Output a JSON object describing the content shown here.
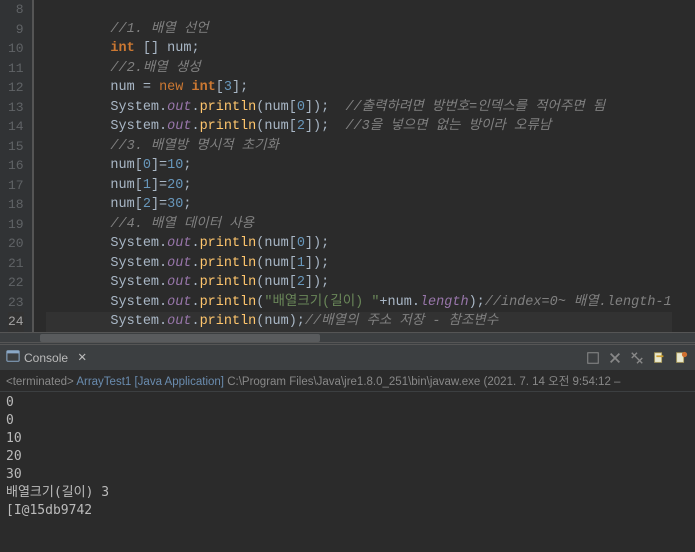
{
  "editor": {
    "lines": [
      {
        "n": 8,
        "html": ""
      },
      {
        "n": 9,
        "html": "        <span class='cm'>//1. 배열 선언</span>"
      },
      {
        "n": 10,
        "html": "        <span class='type'>int</span> <span class='pn'>[]</span> <span class='var'>num</span><span class='pn'>;</span>"
      },
      {
        "n": 11,
        "html": "        <span class='cm'>//2.배열 생성</span>"
      },
      {
        "n": 12,
        "html": "        <span class='var'>num</span> <span class='op'>=</span> <span class='kw'>new</span> <span class='type'>int</span><span class='pn'>[</span><span class='num'>3</span><span class='pn'>];</span>"
      },
      {
        "n": 13,
        "html": "        <span class='cls'>System</span><span class='pn'>.</span><span class='fld'>out</span><span class='pn'>.</span><span class='fn'>println</span><span class='pn'>(</span><span class='var'>num</span><span class='pn'>[</span><span class='num'>0</span><span class='pn'>]);</span>  <span class='cm'>//출력하려면 방번호=인덱스를 적어주면 됨</span>"
      },
      {
        "n": 14,
        "html": "        <span class='cls'>System</span><span class='pn'>.</span><span class='fld'>out</span><span class='pn'>.</span><span class='fn'>println</span><span class='pn'>(</span><span class='var'>num</span><span class='pn'>[</span><span class='num'>2</span><span class='pn'>]);</span>  <span class='cm'>//3을 넣으면 없는 방이라 오류남</span>"
      },
      {
        "n": 15,
        "html": "        <span class='cm'>//3. 배열방 명시적 초기화</span>"
      },
      {
        "n": 16,
        "html": "        <span class='var'>num</span><span class='pn'>[</span><span class='num'>0</span><span class='pn'>]=</span><span class='num'>10</span><span class='pn'>;</span>"
      },
      {
        "n": 17,
        "html": "        <span class='var'>num</span><span class='pn'>[</span><span class='num'>1</span><span class='pn'>]=</span><span class='num'>20</span><span class='pn'>;</span>"
      },
      {
        "n": 18,
        "html": "        <span class='var'>num</span><span class='pn'>[</span><span class='num'>2</span><span class='pn'>]=</span><span class='num'>30</span><span class='pn'>;</span>"
      },
      {
        "n": 19,
        "html": "        <span class='cm'>//4. 배열 데이터 사용</span>"
      },
      {
        "n": 20,
        "html": "        <span class='cls'>System</span><span class='pn'>.</span><span class='fld'>out</span><span class='pn'>.</span><span class='fn'>println</span><span class='pn'>(</span><span class='var'>num</span><span class='pn'>[</span><span class='num'>0</span><span class='pn'>]);</span>"
      },
      {
        "n": 21,
        "html": "        <span class='cls'>System</span><span class='pn'>.</span><span class='fld'>out</span><span class='pn'>.</span><span class='fn'>println</span><span class='pn'>(</span><span class='var'>num</span><span class='pn'>[</span><span class='num'>1</span><span class='pn'>]);</span>"
      },
      {
        "n": 22,
        "html": "        <span class='cls'>System</span><span class='pn'>.</span><span class='fld'>out</span><span class='pn'>.</span><span class='fn'>println</span><span class='pn'>(</span><span class='var'>num</span><span class='pn'>[</span><span class='num'>2</span><span class='pn'>]);</span>"
      },
      {
        "n": 23,
        "html": "        <span class='cls'>System</span><span class='pn'>.</span><span class='fld'>out</span><span class='pn'>.</span><span class='fn'>println</span><span class='pn'>(</span><span class='str'>\"배열크기(길이) \"</span><span class='op'>+</span><span class='var'>num</span><span class='pn'>.</span><span class='fld'>length</span><span class='pn'>);</span><span class='cm'>//index=0~ 배열.length-1</span>"
      },
      {
        "n": 24,
        "hl": true,
        "html": "        <span class='cls'>System</span><span class='pn'>.</span><span class='fld'>out</span><span class='pn'>.</span><span class='fn'>println</span><span class='pn'>(</span><span class='var'>num</span><span class='pn'>);</span><span class='cm'>//배열의 주소 저장 - 참조변수</span>"
      }
    ]
  },
  "console": {
    "tab_label": "Console",
    "status_prefix": "<terminated>",
    "status_app": "ArrayTest1 [Java Application]",
    "status_path": "C:\\Program Files\\Java\\jre1.8.0_251\\bin\\javaw.exe",
    "status_time": "(2021. 7. 14 오전 9:54:12 –",
    "output": [
      "0",
      "0",
      "10",
      "20",
      "30",
      "배열크기(길이) 3",
      "[I@15db9742"
    ]
  }
}
